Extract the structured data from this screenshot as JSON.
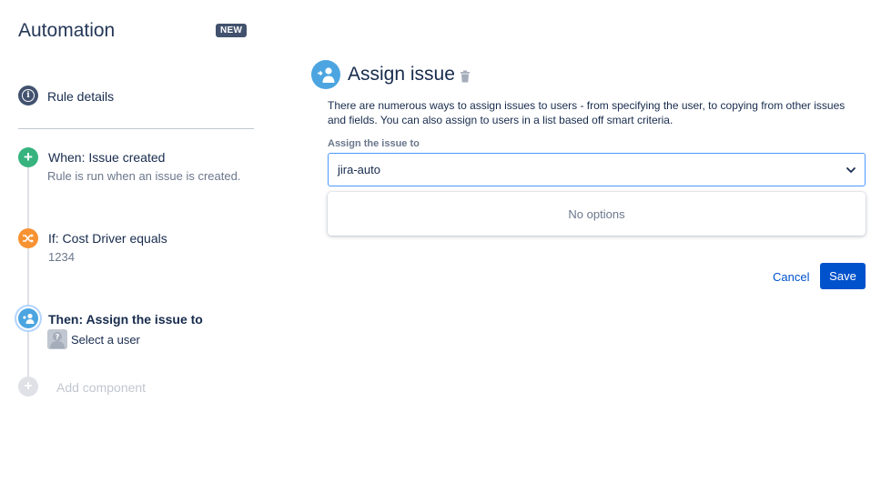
{
  "header": {
    "title": "Automation",
    "badge": "NEW"
  },
  "steps": {
    "details": {
      "label": "Rule details",
      "icon": "info-icon"
    },
    "when": {
      "label": "When: Issue created",
      "sub": "Rule is run when an issue is created.",
      "icon": "plus-icon",
      "color": "#36b37e"
    },
    "if": {
      "label": "If: Cost Driver equals",
      "sub": "1234",
      "icon": "shuffle-icon",
      "color": "#f79232"
    },
    "then": {
      "label": "Then: Assign the issue to",
      "sub": "Select a user",
      "icon": "assign-user-icon",
      "color": "#4ca5e0"
    },
    "add": {
      "label": "Add component",
      "icon": "plus-icon"
    }
  },
  "panel": {
    "title": "Assign issue",
    "description": "There are numerous ways to assign issues to users - from specifying the user, to copying from other issues and fields. You can also assign to users in a list based off smart criteria.",
    "field_label": "Assign the issue to",
    "select_value": "jira-auto",
    "dropdown_message": "No options",
    "cancel_label": "Cancel",
    "save_label": "Save"
  },
  "colors": {
    "primary": "#0052cc",
    "focus_border": "#4c9aff"
  }
}
